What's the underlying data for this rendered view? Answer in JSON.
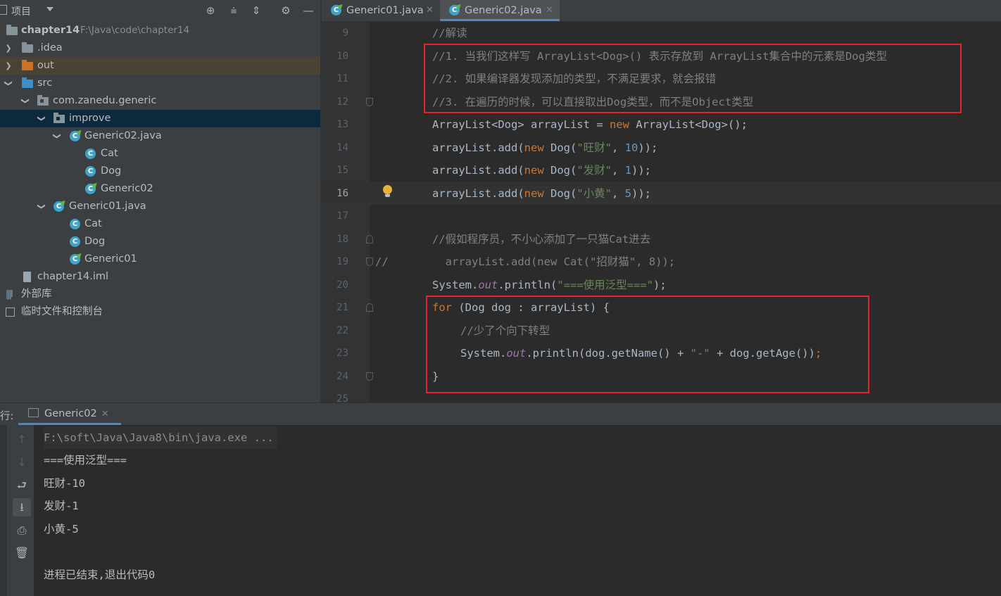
{
  "project_panel": {
    "title": "项目",
    "toolbar_icons": [
      "crosshair-icon",
      "expand-all-icon",
      "collapse-all-icon",
      "gear-icon",
      "minimize-icon"
    ],
    "tree": {
      "root_name": "chapter14",
      "root_path": "F:\\Java\\code\\chapter14",
      "idea": ".idea",
      "out": "out",
      "src": "src",
      "package": "com.zanedu.generic",
      "improve": "improve",
      "file_generic02": "Generic02.java",
      "g2_cat": "Cat",
      "g2_dog": "Dog",
      "g2_main": "Generic02",
      "file_generic01": "Generic01.java",
      "g1_cat": "Cat",
      "g1_dog": "Dog",
      "g1_main": "Generic01",
      "iml": "chapter14.iml",
      "ext_libs": "外部库",
      "scratches": "临时文件和控制台"
    }
  },
  "editor": {
    "tabs": [
      {
        "label": "Generic01.java",
        "active": false
      },
      {
        "label": "Generic02.java",
        "active": true
      }
    ],
    "line_numbers": [
      "9",
      "10",
      "11",
      "12",
      "13",
      "14",
      "15",
      "16",
      "17",
      "18",
      "19",
      "20",
      "21",
      "22",
      "23",
      "24",
      "25"
    ],
    "current_line": "16",
    "code": {
      "l9": "//解读",
      "l10": "//1. 当我们这样写 ArrayList<Dog>() 表示存放到 ArrayList集合中的元素是Dog类型",
      "l11": "//2. 如果编译器发现添加的类型，不满足要求，就会报错",
      "l12": "//3. 在遍历的时候，可以直接取出Dog类型，而不是Object类型",
      "l13_a": "ArrayList<Dog> arrayList = ",
      "kw_new": "new",
      "l13_b": " ArrayList<Dog>();",
      "l14_a": "arrayList.add(",
      "l14_b": " Dog(",
      "l14_s": "\"旺财\"",
      "l14_n": "10",
      "l15_s": "\"发财\"",
      "l15_n": "1",
      "l16_s": "\"小黄\"",
      "l16_n": "5",
      "comma": ", ",
      "close": "));",
      "semi": ";",
      "l18": "//假如程序员，不小心添加了一只猫Cat进去",
      "l19_prefix": "//",
      "l19": "  arrayList.add(new Cat(\"招财猫\", 8));",
      "sys": "System.",
      "out": "out",
      "println": ".println(",
      "l20_s": "\"===使用泛型===\"",
      "l20_end": ");",
      "kw_for": "for",
      "l21": " (Dog dog : arrayList) {",
      "l22": "//少了个向下转型",
      "l23_a": "println(dog.getName() + ",
      "l23_s": "\"-\"",
      "l23_b": " + dog.getAge())",
      "l24": "}"
    }
  },
  "run_panel": {
    "label": "行:",
    "tab": "Generic02",
    "toolbar_icons": [
      "arrow-up-icon",
      "arrow-down-icon",
      "soft-wrap-icon",
      "scroll-to-end-icon",
      "print-icon",
      "trash-icon"
    ],
    "console": {
      "cmd": "F:\\soft\\Java\\Java8\\bin\\java.exe ...",
      "line1": "===使用泛型===",
      "line2": "旺财-10",
      "line3": "发财-1",
      "line4": "小黄-5",
      "exit": "进程已结束,退出代码0"
    }
  },
  "colors": {
    "keyword": "#cc7832",
    "string": "#6a8759",
    "number": "#6897bb",
    "comment": "#808080",
    "highlight_box": "#e3232d",
    "selection": "#0d293e"
  }
}
